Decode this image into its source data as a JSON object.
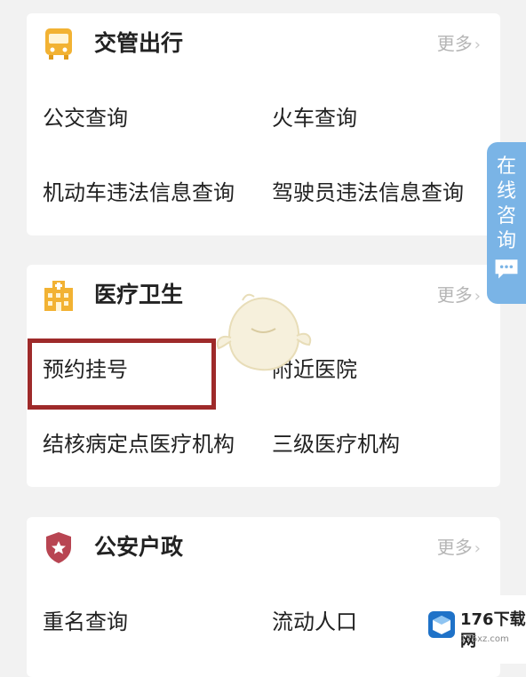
{
  "sections": [
    {
      "title": "交管出行",
      "more": "更多",
      "icon": "bus-icon",
      "items": [
        "公交查询",
        "火车查询",
        "机动车违法信息查询",
        "驾驶员违法信息查询"
      ]
    },
    {
      "title": "医疗卫生",
      "more": "更多",
      "icon": "hospital-icon",
      "items": [
        "预约挂号",
        "附近医院",
        "结核病定点医疗机构",
        "三级医疗机构"
      ]
    },
    {
      "title": "公安户政",
      "more": "更多",
      "icon": "police-badge-icon",
      "items": [
        "重名查询",
        "流动人口"
      ]
    }
  ],
  "side_tab": {
    "label": "在线咨询",
    "icon": "chat-bubble-icon"
  },
  "watermark": {
    "text": "176下载网",
    "sub": "176xz.com"
  },
  "colors": {
    "accent_icon": "#f2b233",
    "side_tab": "#7ab4e6",
    "highlight": "#9e2a2a",
    "police_icon": "#b84552"
  }
}
